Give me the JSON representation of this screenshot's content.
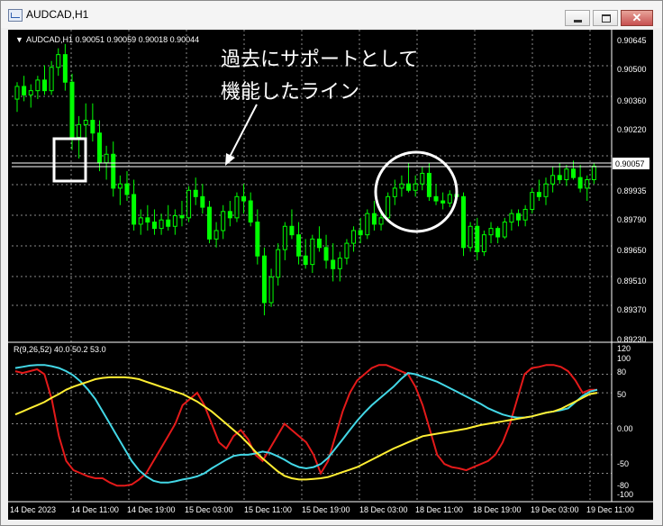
{
  "window": {
    "title": "AUDCAD,H1"
  },
  "colors": {
    "background": "#000000",
    "candle": "#00ff00",
    "grid": "#8a8a8a",
    "axis_text": "#ffffff",
    "rsi_red": "#e41a1a",
    "rsi_cyan": "#43d7e6",
    "rsi_yellow": "#ffee33",
    "annotation": "#ffffff"
  },
  "price_panel": {
    "info_label": "AUDCAD,H1  0.90051 0.90059 0.90018 0.90044",
    "price_ticks": [
      "0.90645",
      "0.90500",
      "0.90360",
      "0.90220",
      "0.90057",
      "0.89935",
      "0.89790",
      "0.89650",
      "0.89510",
      "0.89370",
      "0.89230"
    ],
    "current_price": "0.90057",
    "support_level_hint": "horizontal support line",
    "annotation_lines": [
      "過去にサポートとして",
      "機能したライン"
    ]
  },
  "indicator_panel": {
    "label": "R(9,26,52) 40.0 50.2 53.0",
    "ticks": [
      "120",
      "100",
      "80",
      "50",
      "0.00",
      "-50",
      "-80",
      "-100"
    ]
  },
  "time_axis": {
    "labels": [
      "14 Dec 2023",
      "14 Dec 11:00",
      "14 Dec 19:00",
      "15 Dec 03:00",
      "15 Dec 11:00",
      "15 Dec 19:00",
      "18 Dec 03:00",
      "18 Dec 11:00",
      "18 Dec 19:00",
      "19 Dec 03:00",
      "19 Dec 11:00"
    ]
  },
  "chart_data": {
    "type": "candlestick",
    "price_ylim": [
      0.8923,
      0.90645
    ],
    "support_level": 0.9005,
    "candles": [
      [
        0.9036,
        0.9044,
        0.903,
        0.9042
      ],
      [
        0.9042,
        0.9047,
        0.9035,
        0.9038
      ],
      [
        0.9038,
        0.9043,
        0.9032,
        0.904
      ],
      [
        0.904,
        0.9047,
        0.9036,
        0.9045
      ],
      [
        0.9045,
        0.9052,
        0.9038,
        0.904
      ],
      [
        0.904,
        0.9054,
        0.9038,
        0.9051
      ],
      [
        0.9051,
        0.906,
        0.9047,
        0.9057
      ],
      [
        0.9057,
        0.9062,
        0.904,
        0.9044
      ],
      [
        0.9044,
        0.9048,
        0.9012,
        0.9018
      ],
      [
        0.9018,
        0.9028,
        0.9008,
        0.9024
      ],
      [
        0.9024,
        0.9034,
        0.9018,
        0.9026
      ],
      [
        0.9026,
        0.9034,
        0.9016,
        0.902
      ],
      [
        0.902,
        0.9026,
        0.9002,
        0.9006
      ],
      [
        0.9006,
        0.9014,
        0.8998,
        0.901
      ],
      [
        0.901,
        0.9016,
        0.899,
        0.8994
      ],
      [
        0.8994,
        0.9,
        0.8986,
        0.8996
      ],
      [
        0.8996,
        0.9002,
        0.8988,
        0.8991
      ],
      [
        0.8991,
        0.8998,
        0.8974,
        0.8977
      ],
      [
        0.8977,
        0.8984,
        0.8972,
        0.898
      ],
      [
        0.898,
        0.8986,
        0.8974,
        0.8978
      ],
      [
        0.8978,
        0.8984,
        0.8972,
        0.8975
      ],
      [
        0.8975,
        0.8982,
        0.8972,
        0.8979
      ],
      [
        0.8979,
        0.8986,
        0.8974,
        0.8976
      ],
      [
        0.8976,
        0.8984,
        0.8972,
        0.8981
      ],
      [
        0.8981,
        0.8988,
        0.8976,
        0.898
      ],
      [
        0.898,
        0.8995,
        0.8978,
        0.8993
      ],
      [
        0.8993,
        0.8999,
        0.8986,
        0.899
      ],
      [
        0.899,
        0.8996,
        0.8982,
        0.8985
      ],
      [
        0.8985,
        0.8988,
        0.8968,
        0.897
      ],
      [
        0.897,
        0.8978,
        0.8966,
        0.8974
      ],
      [
        0.8974,
        0.8986,
        0.897,
        0.8983
      ],
      [
        0.8983,
        0.8988,
        0.8976,
        0.898
      ],
      [
        0.898,
        0.8992,
        0.8978,
        0.899
      ],
      [
        0.899,
        0.8996,
        0.8982,
        0.8988
      ],
      [
        0.8988,
        0.8992,
        0.8976,
        0.8978
      ],
      [
        0.8978,
        0.8984,
        0.8958,
        0.8962
      ],
      [
        0.8962,
        0.8966,
        0.8934,
        0.894
      ],
      [
        0.894,
        0.8956,
        0.8938,
        0.8952
      ],
      [
        0.8952,
        0.8968,
        0.8948,
        0.8965
      ],
      [
        0.8965,
        0.8978,
        0.896,
        0.8976
      ],
      [
        0.8976,
        0.8984,
        0.897,
        0.8972
      ],
      [
        0.8972,
        0.8978,
        0.8958,
        0.8962
      ],
      [
        0.8962,
        0.897,
        0.8956,
        0.8958
      ],
      [
        0.8958,
        0.8972,
        0.8954,
        0.897
      ],
      [
        0.897,
        0.8976,
        0.8964,
        0.8966
      ],
      [
        0.8966,
        0.8972,
        0.8956,
        0.896
      ],
      [
        0.896,
        0.8968,
        0.895,
        0.8956
      ],
      [
        0.8956,
        0.8964,
        0.895,
        0.8961
      ],
      [
        0.8961,
        0.897,
        0.8958,
        0.8968
      ],
      [
        0.8968,
        0.8976,
        0.8964,
        0.8974
      ],
      [
        0.8974,
        0.898,
        0.8968,
        0.8972
      ],
      [
        0.8972,
        0.8984,
        0.897,
        0.8982
      ],
      [
        0.8982,
        0.8988,
        0.8974,
        0.8977
      ],
      [
        0.8977,
        0.8984,
        0.8974,
        0.898
      ],
      [
        0.898,
        0.8992,
        0.8978,
        0.899
      ],
      [
        0.899,
        0.8998,
        0.8986,
        0.8994
      ],
      [
        0.8994,
        0.9,
        0.899,
        0.8996
      ],
      [
        0.8996,
        0.9006,
        0.8992,
        0.8993
      ],
      [
        0.8993,
        0.9,
        0.899,
        0.8996
      ],
      [
        0.8996,
        0.9004,
        0.8993,
        0.9001
      ],
      [
        0.9001,
        0.9006,
        0.8988,
        0.899
      ],
      [
        0.899,
        0.8996,
        0.8986,
        0.8988
      ],
      [
        0.8988,
        0.8992,
        0.8984,
        0.8987
      ],
      [
        0.8987,
        0.8993,
        0.8985,
        0.8991
      ],
      [
        0.8991,
        0.8996,
        0.8988,
        0.899
      ],
      [
        0.899,
        0.8992,
        0.8962,
        0.8966
      ],
      [
        0.8966,
        0.8978,
        0.8964,
        0.8976
      ],
      [
        0.8976,
        0.898,
        0.896,
        0.8964
      ],
      [
        0.8964,
        0.8974,
        0.8962,
        0.8972
      ],
      [
        0.8972,
        0.8978,
        0.8968,
        0.8975
      ],
      [
        0.8975,
        0.8976,
        0.8968,
        0.8971
      ],
      [
        0.8971,
        0.898,
        0.897,
        0.8978
      ],
      [
        0.8978,
        0.8984,
        0.8974,
        0.8982
      ],
      [
        0.8982,
        0.8984,
        0.8976,
        0.8979
      ],
      [
        0.8979,
        0.8986,
        0.8976,
        0.8984
      ],
      [
        0.8984,
        0.8994,
        0.8982,
        0.8992
      ],
      [
        0.8992,
        0.8998,
        0.8988,
        0.899
      ],
      [
        0.899,
        0.8999,
        0.8986,
        0.8996
      ],
      [
        0.8996,
        0.9004,
        0.8992,
        0.9
      ],
      [
        0.9,
        0.9006,
        0.8996,
        0.8998
      ],
      [
        0.8998,
        0.9005,
        0.8995,
        0.9003
      ],
      [
        0.9003,
        0.9007,
        0.8998,
        0.8999
      ],
      [
        0.8999,
        0.9005,
        0.8992,
        0.8994
      ],
      [
        0.8994,
        0.9,
        0.8988,
        0.8998
      ],
      [
        0.8998,
        0.9006,
        0.8996,
        0.90044
      ]
    ],
    "indicator": {
      "ylim": [
        -120,
        120
      ],
      "series": [
        {
          "name": "",
          "color_key": "rsi_red",
          "values": [
            85,
            82,
            85,
            88,
            80,
            40,
            -20,
            -60,
            -75,
            -80,
            -85,
            -88,
            -88,
            -95,
            -100,
            -100,
            -98,
            -90,
            -80,
            -60,
            -40,
            -20,
            0,
            30,
            40,
            50,
            30,
            0,
            -30,
            -40,
            -20,
            -10,
            -25,
            -50,
            -60,
            -40,
            -20,
            0,
            -10,
            -20,
            -30,
            -50,
            -80,
            -60,
            -20,
            20,
            50,
            70,
            80,
            90,
            95,
            95,
            90,
            85,
            80,
            60,
            30,
            -10,
            -50,
            -65,
            -70,
            -72,
            -75,
            -70,
            -65,
            -60,
            -50,
            -30,
            0,
            40,
            80,
            90,
            92,
            95,
            95,
            92,
            85,
            70,
            50,
            55,
            55
          ]
        },
        {
          "name": "",
          "color_key": "rsi_cyan",
          "values": [
            90,
            92,
            94,
            95,
            95,
            93,
            90,
            85,
            78,
            68,
            55,
            40,
            20,
            0,
            -20,
            -40,
            -60,
            -75,
            -85,
            -92,
            -95,
            -95,
            -93,
            -90,
            -88,
            -85,
            -80,
            -72,
            -65,
            -58,
            -52,
            -50,
            -50,
            -48,
            -45,
            -47,
            -52,
            -58,
            -65,
            -70,
            -72,
            -70,
            -65,
            -55,
            -40,
            -25,
            -10,
            5,
            18,
            30,
            40,
            50,
            60,
            72,
            82,
            80,
            76,
            72,
            68,
            62,
            56,
            50,
            44,
            38,
            32,
            25,
            20,
            15,
            12,
            10,
            10,
            12,
            15,
            18,
            20,
            22,
            25,
            35,
            45,
            52,
            55
          ]
        },
        {
          "name": "",
          "color_key": "rsi_yellow",
          "values": [
            15,
            20,
            25,
            30,
            35,
            42,
            48,
            55,
            60,
            64,
            68,
            72,
            74,
            75,
            75,
            75,
            74,
            72,
            68,
            64,
            60,
            56,
            52,
            48,
            42,
            36,
            28,
            20,
            10,
            0,
            -10,
            -20,
            -32,
            -45,
            -56,
            -66,
            -76,
            -84,
            -88,
            -90,
            -90,
            -89,
            -88,
            -86,
            -82,
            -78,
            -74,
            -70,
            -64,
            -58,
            -52,
            -46,
            -40,
            -35,
            -30,
            -25,
            -20,
            -18,
            -16,
            -14,
            -12,
            -10,
            -8,
            -5,
            -2,
            0,
            2,
            4,
            6,
            8,
            10,
            12,
            15,
            18,
            20,
            24,
            30,
            36,
            42,
            48,
            50
          ]
        }
      ]
    }
  }
}
